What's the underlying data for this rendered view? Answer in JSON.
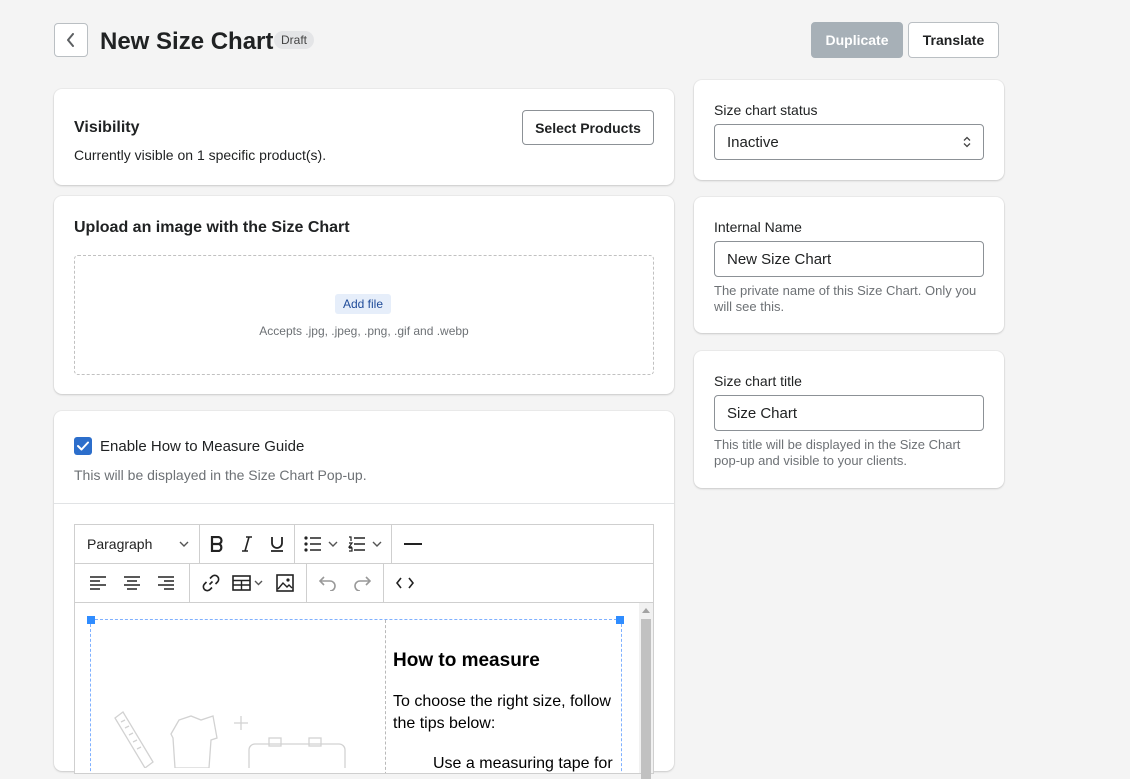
{
  "header": {
    "title": "New Size Chart",
    "badge": "Draft",
    "duplicate_label": "Duplicate",
    "translate_label": "Translate"
  },
  "visibility": {
    "title": "Visibility",
    "description": "Currently visible on 1 specific product(s).",
    "select_products_label": "Select Products"
  },
  "upload": {
    "title": "Upload an image with the Size Chart",
    "add_file_label": "Add file",
    "accepts_text": "Accepts .jpg, .jpeg, .png, .gif and .webp"
  },
  "guide": {
    "checkbox_label": "Enable How to Measure Guide",
    "checked": true,
    "description": "This will be displayed in the Size Chart Pop-up."
  },
  "editor": {
    "block_format": "Paragraph",
    "content_heading": "How to measure",
    "content_paragraph": "To choose the right size, follow the tips below:",
    "content_partial": "Use a measuring tape for"
  },
  "status": {
    "label": "Size chart status",
    "value": "Inactive"
  },
  "internal_name": {
    "label": "Internal Name",
    "value": "New Size Chart",
    "help": "The private name of this Size Chart. Only you will see this."
  },
  "chart_title": {
    "label": "Size chart title",
    "value": "Size Chart",
    "help": "This title will be displayed in the Size Chart pop-up and visible to your clients."
  },
  "colors": {
    "accent": "#2c6ecb",
    "disabled_button": "#a7b0b7",
    "background": "#f4f4f4"
  }
}
